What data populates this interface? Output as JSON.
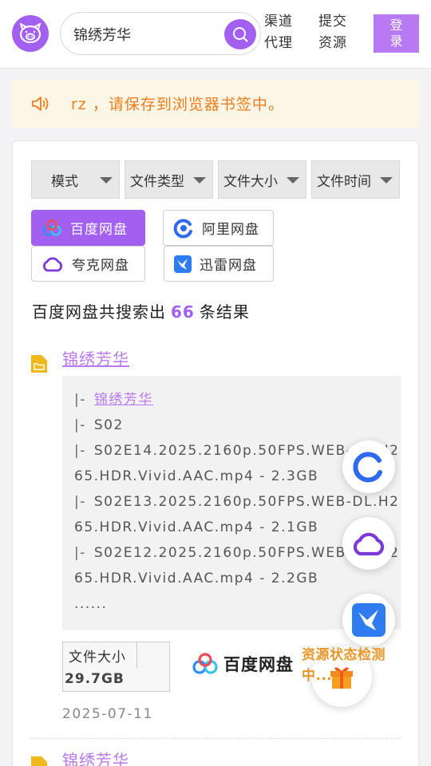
{
  "header": {
    "search_value": "锦绣芳华",
    "nav": [
      {
        "label_line1": "渠道",
        "label_line2": "代理"
      },
      {
        "label_line1": "提交",
        "label_line2": "资源"
      }
    ],
    "login_label": "登录"
  },
  "notice": {
    "text": "rz ，请保存到浏览器书签中。"
  },
  "filters": [
    "模式",
    "文件类型",
    "文件大小",
    "文件时间"
  ],
  "disks": [
    {
      "label": "百度网盘",
      "active": true
    },
    {
      "label": "阿里网盘",
      "active": false
    },
    {
      "label": "夸克网盘",
      "active": false
    },
    {
      "label": "迅雷网盘",
      "active": false
    }
  ],
  "results": {
    "prefix": "百度网盘共搜索出",
    "count": "66",
    "suffix": "条结果"
  },
  "items": [
    {
      "title": "锦绣芳华",
      "tree": [
        {
          "bar": "|-",
          "text": "锦绣芳华",
          "link": true
        },
        {
          "bar": "|-",
          "text": "S02"
        },
        {
          "bar": "|-",
          "text": "S02E14.2025.2160p.50FPS.WEB-DL.H2"
        },
        {
          "bar": "",
          "text": "65.HDR.Vivid.AAC.mp4 - 2.3GB"
        },
        {
          "bar": "|-",
          "text": "S02E13.2025.2160p.50FPS.WEB-DL.H2"
        },
        {
          "bar": "",
          "text": "65.HDR.Vivid.AAC.mp4 - 2.1GB"
        },
        {
          "bar": "|-",
          "text": "S02E12.2025.2160p.50FPS.WEB-DL.H2"
        },
        {
          "bar": "",
          "text": "65.HDR.Vivid.AAC.mp4 - 2.2GB"
        },
        {
          "bar": "",
          "text": "......"
        }
      ],
      "size_label": "文件大小",
      "size_value": "29.7GB",
      "source": "百度网盘",
      "date": "2025-07-11"
    },
    {
      "title": "锦绣芳华"
    }
  ],
  "floating": {
    "status_text": "资源状态检测中..."
  },
  "colors": {
    "accent": "#a35ff0",
    "accent_light": "#b77af3",
    "notice_bg": "#fdf6e6",
    "notice_text": "#f07d1a"
  },
  "icons": [
    "pig-logo-icon",
    "search-icon",
    "speaker-icon",
    "folder-icon",
    "baidu-disk-icon",
    "aliyun-disk-icon",
    "quark-disk-icon",
    "xunlei-disk-icon",
    "gift-icon"
  ]
}
